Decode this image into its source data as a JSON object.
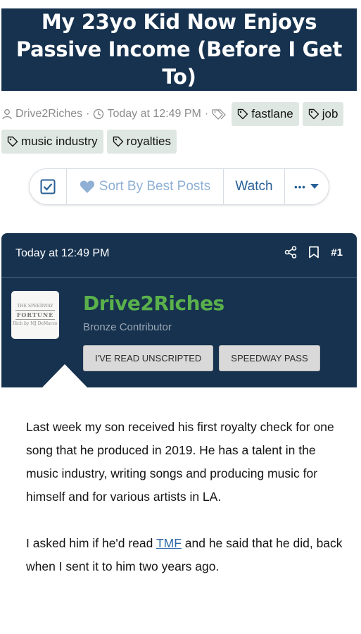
{
  "thread": {
    "title": "My 23yo Kid Now Enjoys Passive Income (Before I Get To)",
    "author": "Drive2Riches",
    "date": "Today at 12:49 PM",
    "tags": [
      "fastlane",
      "job",
      "music industry",
      "royalties"
    ]
  },
  "toolbar": {
    "sort_label": "Sort By Best Posts",
    "watch_label": "Watch",
    "more_label": "•••"
  },
  "post": {
    "date": "Today at 12:49 PM",
    "number": "#1",
    "username": "Drive2Riches",
    "user_title": "Bronze Contributor",
    "badges": [
      "I'VE READ UNSCRIPTED",
      "SPEEDWAY PASS"
    ],
    "avatar_text": {
      "top": "THE SPEEDWAY",
      "main": "FORTUNE",
      "bottom": "Rich by MJ DeMarco"
    },
    "paragraph1": "Last week my son received his first royalty check for one song that he produced in 2019. He has a talent in the music industry, writing songs and producing music for himself and for various artists in LA.",
    "paragraph2_before": "I asked him if he'd read ",
    "paragraph2_link": "TMF",
    "paragraph2_after": " and he said that he did, back when I sent it to him two years ago."
  },
  "colors": {
    "header_bg": "#17324f",
    "username": "#5ab14b",
    "link": "#2f6aa8",
    "tag_bg": "#dfe7e3"
  }
}
